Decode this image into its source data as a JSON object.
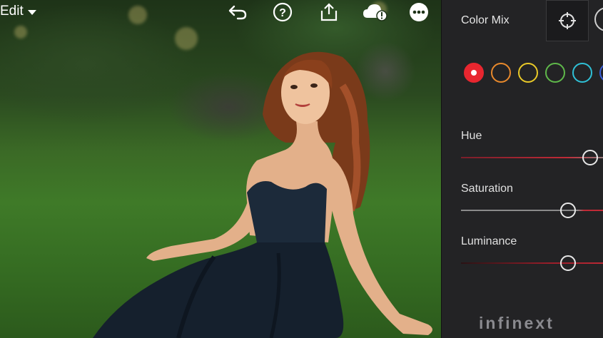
{
  "toolbar": {
    "edit_label": "Edit",
    "icons": [
      "undo-icon",
      "help-icon",
      "share-icon",
      "cloud-alert-icon",
      "more-icon"
    ]
  },
  "panel": {
    "title": "Color Mix",
    "color_swatches": [
      {
        "name": "red",
        "color": "#e8262f",
        "selected": true
      },
      {
        "name": "orange",
        "color": "#e8892c",
        "selected": false
      },
      {
        "name": "yellow",
        "color": "#e9c928",
        "selected": false
      },
      {
        "name": "green",
        "color": "#5fb84a",
        "selected": false
      },
      {
        "name": "aqua",
        "color": "#2fc0d6",
        "selected": false
      },
      {
        "name": "blue",
        "color": "#3a5fd8",
        "selected": false
      }
    ],
    "sliders": [
      {
        "label": "Hue",
        "value_fraction": 0.86
      },
      {
        "label": "Saturation",
        "value_fraction": 0.5
      },
      {
        "label": "Luminance",
        "value_fraction": 0.5
      }
    ]
  },
  "watermark": "infinext"
}
